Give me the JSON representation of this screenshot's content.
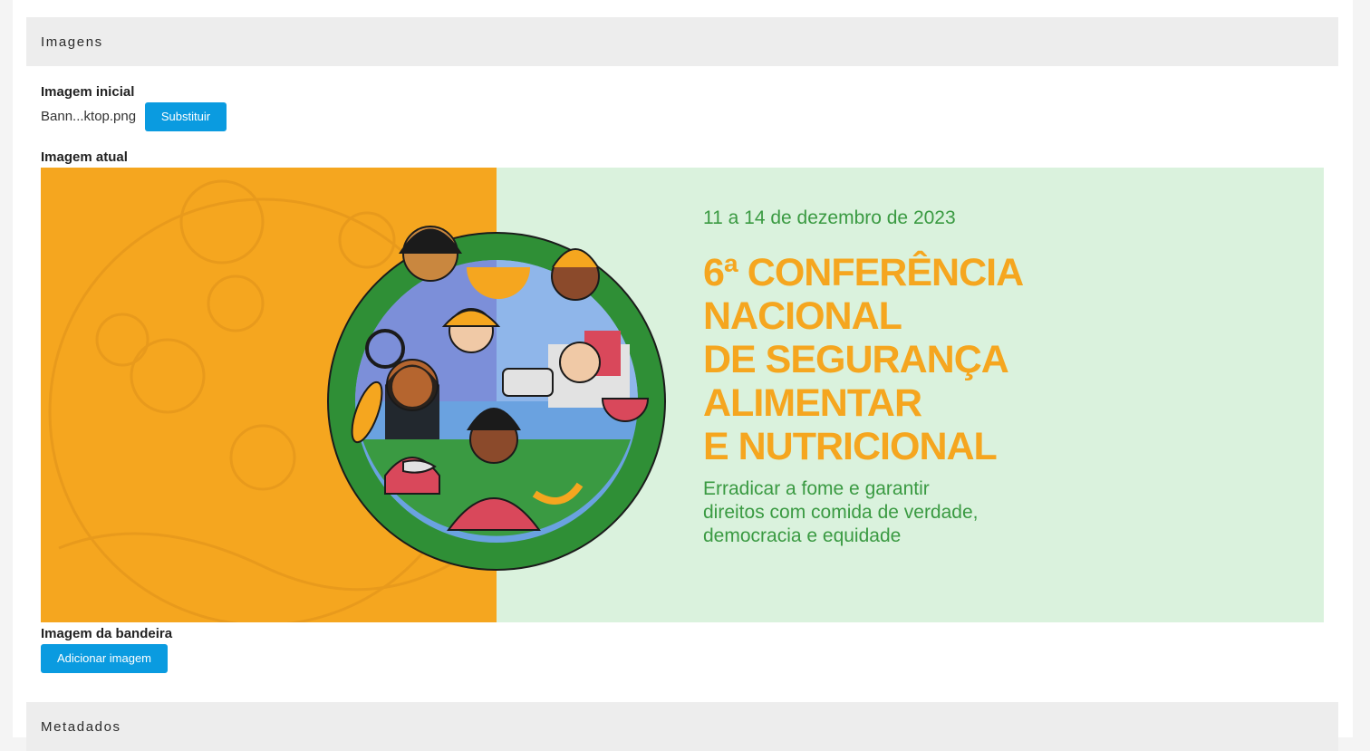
{
  "sections": {
    "imagens": "Imagens",
    "metadados": "Metadados"
  },
  "imagem_inicial": {
    "label": "Imagem inicial",
    "filename": "Bann...ktop.png",
    "button": "Substituir"
  },
  "imagem_atual": {
    "label": "Imagem atual",
    "banner": {
      "date": "11 a 14 de dezembro de 2023",
      "title_lines": [
        "6ª CONFERÊNCIA",
        "NACIONAL",
        "DE SEGURANÇA",
        "ALIMENTAR",
        "E NUTRICIONAL"
      ],
      "subtitle_lines": [
        "Erradicar a fome e garantir",
        "direitos com comida de verdade,",
        "democracia e equidade"
      ]
    }
  },
  "imagem_bandeira": {
    "label": "Imagem da bandeira",
    "button": "Adicionar imagem"
  },
  "colors": {
    "button": "#0a9be0",
    "banner_orange": "#f5a61f",
    "banner_green_light": "#daf2dd",
    "banner_green": "#2f8f36"
  }
}
